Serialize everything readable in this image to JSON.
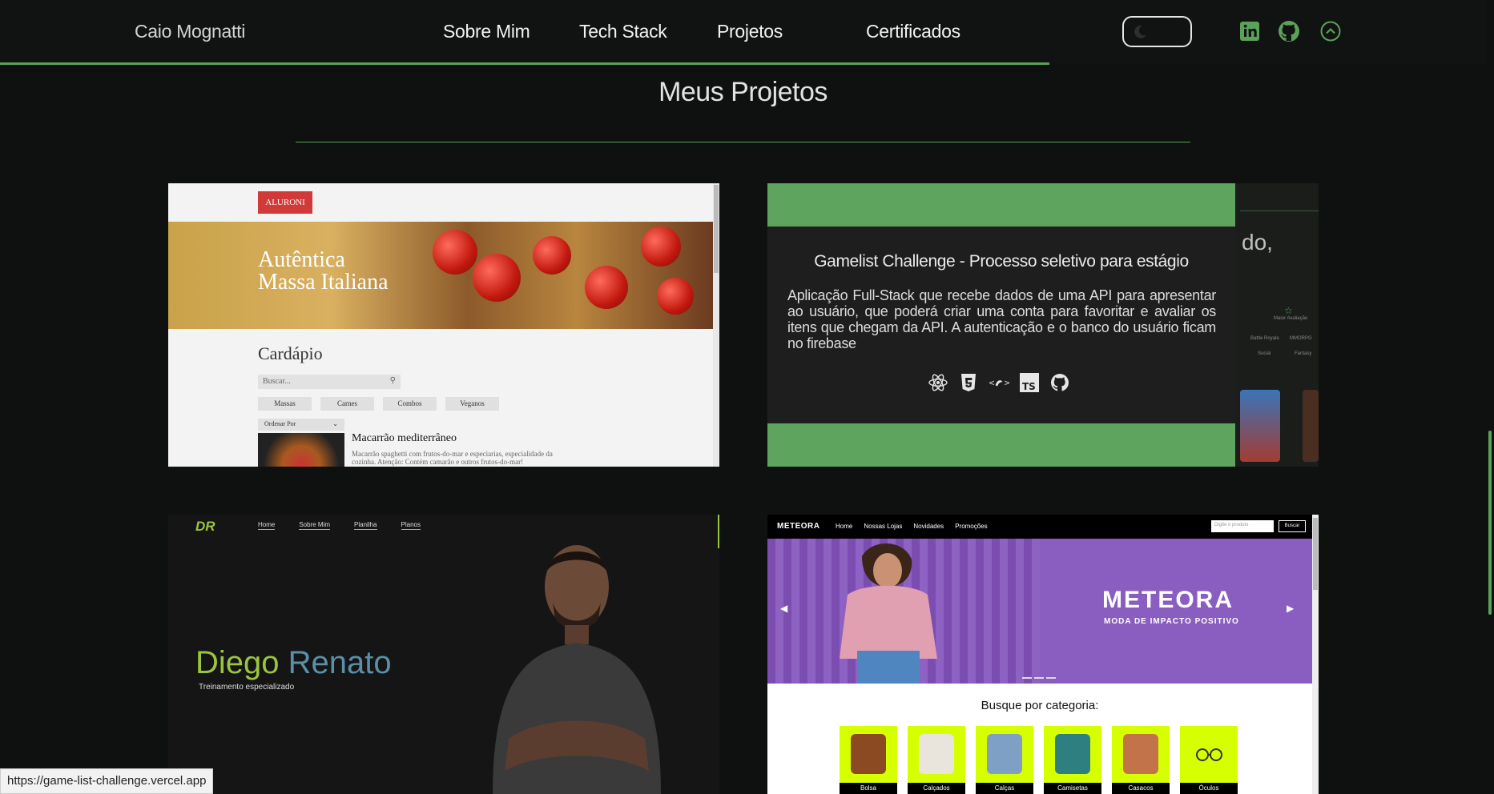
{
  "nav": {
    "brand": "Caio Mognatti",
    "links": [
      "Sobre Mim",
      "Tech Stack",
      "Projetos",
      "Certificados"
    ],
    "social": [
      "linkedin-icon",
      "github-icon",
      "arrow-up-circle-icon"
    ],
    "accent": "#5aa25a"
  },
  "section": {
    "title": "Meus Projetos"
  },
  "projects": [
    {
      "preview": {
        "logo": "ALURONI",
        "hero_line1": "Autêntica",
        "hero_line2": "Massa Italiana",
        "heading": "Cardápio",
        "search_placeholder": "Buscar...",
        "filters": [
          "Massas",
          "Carnes",
          "Combos",
          "Veganos"
        ],
        "order_by": "Ordenar Por",
        "dish_name": "Macarrão mediterrâneo",
        "dish_desc": "Macarrão spaghetti com frutos-do-mar e especiarias, especialidade da cozinha. Atenção: Contém camarão e outros frutos-do-mar!"
      }
    },
    {
      "title": "Gamelist Challenge - Processo seletivo para estágio",
      "description": "Aplicação Full-Stack que recebe dados de uma API para apresentar ao usuário, que poderá criar uma conta para favoritar e avaliar os itens que chegam da API. A autenticação e o banco do usuário ficam no firebase",
      "tech_icons": [
        "react-icon",
        "html5-icon",
        "styled-components-icon",
        "typescript-icon",
        "github-icon"
      ],
      "peek_text": "do,",
      "peek_rating": "Maior Avaliação",
      "peek_tags": [
        "Battle Royale",
        "MMORPG",
        "Social",
        "Fantasy"
      ]
    },
    {
      "preview": {
        "logo": "DR",
        "nav": [
          "Home",
          "Sobre Mim",
          "Planilha",
          "Planos"
        ],
        "name_first": "Diego",
        "name_last": "Renato",
        "tagline": "Treinamento especializado"
      }
    },
    {
      "preview": {
        "logo": "METEORA",
        "nav": [
          "Home",
          "Nossas Lojas",
          "Novidades",
          "Promoções"
        ],
        "search_placeholder": "Digite o produto",
        "search_button": "Buscar",
        "banner_title": "METEORA",
        "banner_sub": "MODA DE IMPACTO POSITIVO",
        "categories_title": "Busque por categoria:",
        "categories": [
          "Bolsa",
          "Calçados",
          "Calças",
          "Camisetas",
          "Casacos",
          "Óculos"
        ]
      }
    }
  ],
  "status_url": "https://game-list-challenge.vercel.app"
}
